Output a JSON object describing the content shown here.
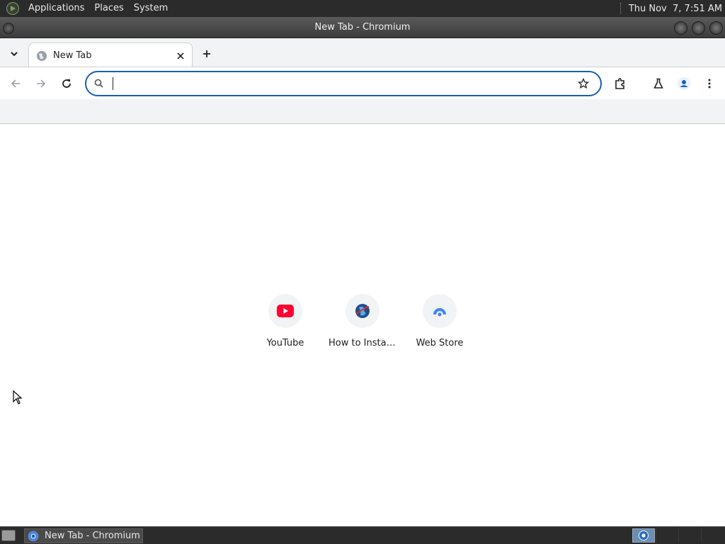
{
  "top_panel": {
    "menus": [
      "Applications",
      "Places",
      "System"
    ],
    "clock": "Thu Nov  7, 7:51 AM"
  },
  "window": {
    "title": "New Tab - Chromium"
  },
  "browser": {
    "tabs": [
      {
        "title": "New Tab",
        "icon": "globe-icon",
        "active": true
      }
    ],
    "omnibox": {
      "value": "",
      "placeholder": ""
    },
    "accent_color": "#1a5fb4"
  },
  "shortcuts": [
    {
      "label": "YouTube",
      "icon": "youtube-icon"
    },
    {
      "label": "How to Instal...",
      "icon": "globe-site-icon"
    },
    {
      "label": "Web Store",
      "icon": "web-store-icon"
    }
  ],
  "taskbar": {
    "task_label": "New Tab - Chromium"
  }
}
